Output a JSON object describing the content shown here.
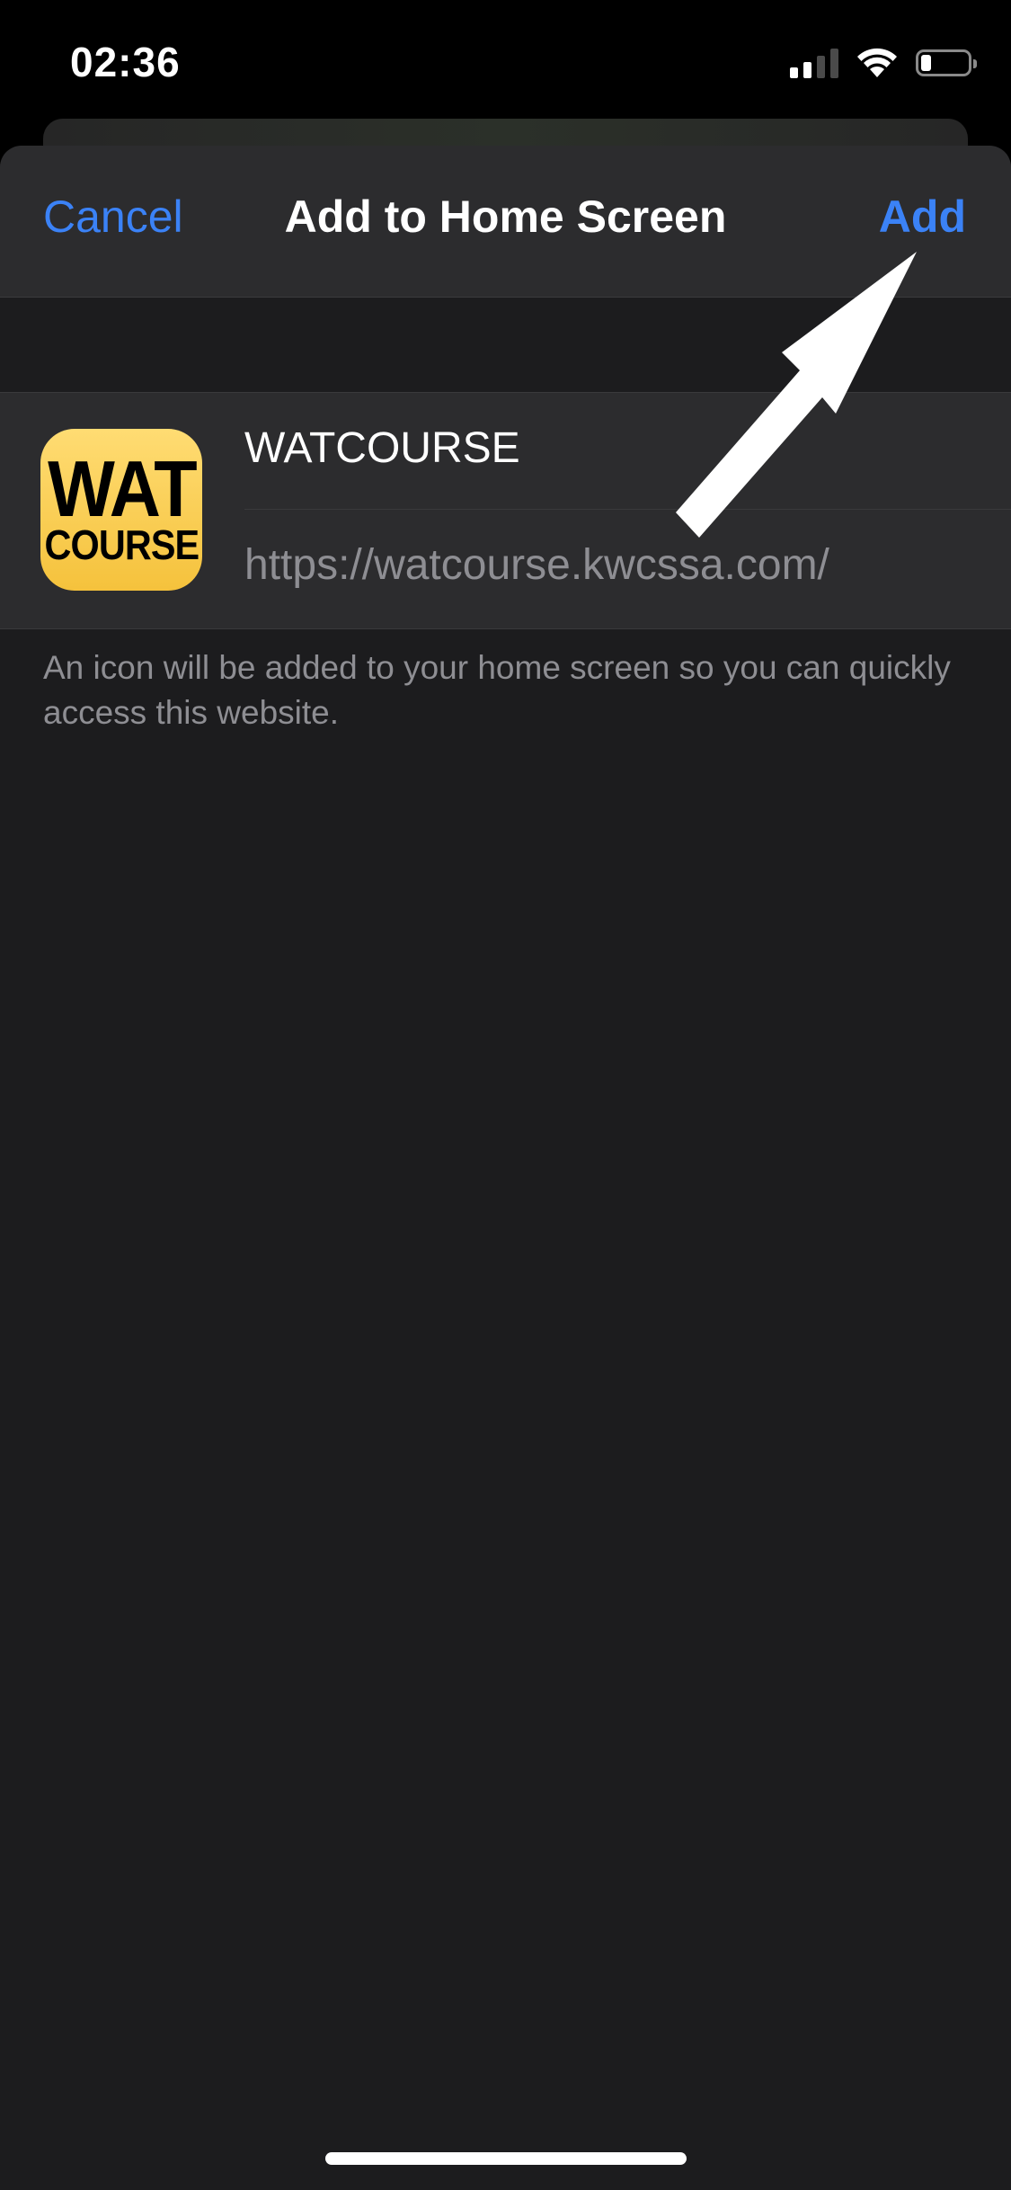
{
  "status_bar": {
    "time": "02:36",
    "signal_icon": "cellular-signal-icon",
    "wifi_icon": "wifi-icon",
    "battery_icon": "battery-icon",
    "battery_level": 0.2
  },
  "nav": {
    "cancel_label": "Cancel",
    "title": "Add to Home Screen",
    "add_label": "Add"
  },
  "bookmark": {
    "icon_name": "watcourse-app-icon",
    "icon_text_line1": "WAT",
    "icon_text_line2": "COURSE",
    "name_value": "WATCOURSE",
    "url": "https://watcourse.kwcssa.com/"
  },
  "caption": "An icon will be added to your home screen so you can quickly access this website.",
  "annotation": {
    "icon_name": "pointer-arrow-icon"
  },
  "colors": {
    "accent": "#3b82f6",
    "sheet_background": "#1c1c1e",
    "group_background": "#2c2c2e",
    "secondary_text": "#8e8e93",
    "icon_yellow": "#f7c844"
  }
}
